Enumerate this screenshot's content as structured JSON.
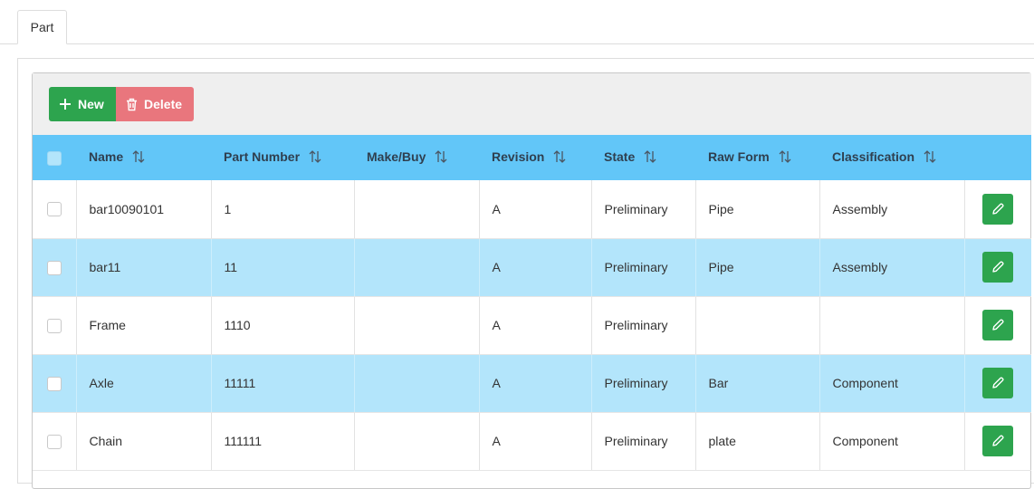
{
  "tabs": [
    {
      "label": "Part"
    }
  ],
  "toolbar": {
    "new_label": "New",
    "delete_label": "Delete"
  },
  "icons": {
    "new": "plus-icon",
    "delete": "trash-icon",
    "edit": "pencil-icon",
    "sort": "sort-icon"
  },
  "colors": {
    "header": "#62c6f8",
    "alt_row": "#b3e5fb",
    "new_button": "#2da44e",
    "delete_button": "#e9767d",
    "edit_button": "#2da44e"
  },
  "table": {
    "columns": [
      "Name",
      "Part Number",
      "Make/Buy",
      "Revision",
      "State",
      "Raw Form",
      "Classification"
    ],
    "rows": [
      [
        "bar10090101",
        "1",
        "",
        "A",
        "Preliminary",
        "Pipe",
        "Assembly"
      ],
      [
        "bar11",
        "11",
        "",
        "A",
        "Preliminary",
        "Pipe",
        "Assembly"
      ],
      [
        "Frame",
        "1110",
        "",
        "A",
        "Preliminary",
        "",
        ""
      ],
      [
        "Axle",
        "11111",
        "",
        "A",
        "Preliminary",
        "Bar",
        "Component"
      ],
      [
        "Chain",
        "111111",
        "",
        "A",
        "Preliminary",
        "plate",
        "Component"
      ]
    ]
  }
}
